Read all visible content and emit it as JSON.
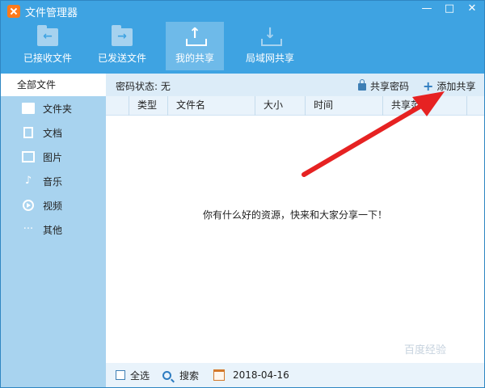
{
  "window": {
    "title": "文件管理器"
  },
  "toolbar": {
    "received": "已接收文件",
    "sent": "已发送文件",
    "my_share": "我的共享",
    "lan_share": "局域网共享"
  },
  "sidebar": {
    "all_files": "全部文件",
    "items": [
      {
        "label": "文件夹",
        "icon": "folder-icon"
      },
      {
        "label": "文档",
        "icon": "document-icon"
      },
      {
        "label": "图片",
        "icon": "image-icon"
      },
      {
        "label": "音乐",
        "icon": "music-icon"
      },
      {
        "label": "视频",
        "icon": "video-icon"
      },
      {
        "label": "其他",
        "icon": "more-icon"
      }
    ]
  },
  "statusbar": {
    "password_status": "密码状态: 无",
    "share_password": "共享密码",
    "add_share": "添加共享"
  },
  "table": {
    "columns": [
      "类型",
      "文件名",
      "大小",
      "时间",
      "共享范"
    ]
  },
  "empty_message": "你有什么好的资源，快来和大家分享一下！",
  "footer": {
    "select_all": "全选",
    "search": "搜索",
    "date": "2018-04-16"
  },
  "watermark": "百度经验",
  "colors": {
    "titlebar": "#3ea3e2",
    "sidebar": "#a8d3ef",
    "annotation_arrow": "#e62222"
  }
}
